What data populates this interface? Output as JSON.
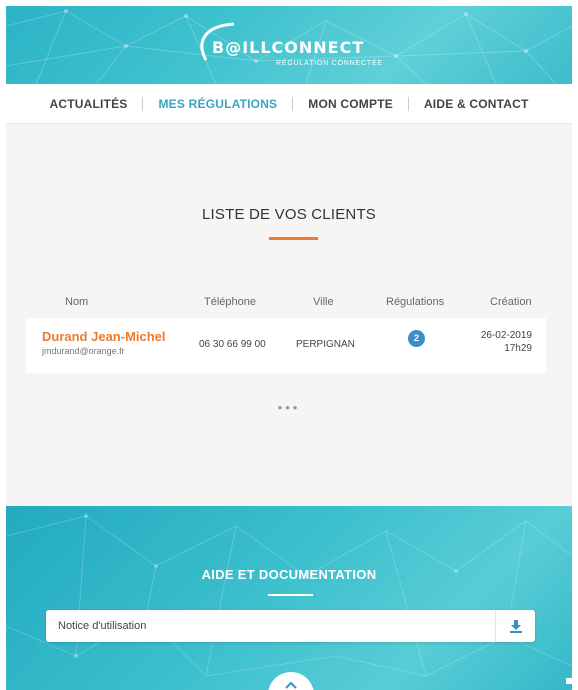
{
  "brand": {
    "name": "B@ILLCONNECT",
    "tagline": "RÉGULATION CONNECTÉE"
  },
  "nav": {
    "items": [
      {
        "label": "ACTUALITÉS",
        "active": false
      },
      {
        "label": "MES RÉGULATIONS",
        "active": true
      },
      {
        "label": "MON COMPTE",
        "active": false
      },
      {
        "label": "AIDE & CONTACT",
        "active": false
      }
    ]
  },
  "clients": {
    "title": "LISTE DE VOS CLIENTS",
    "columns": {
      "name": "Nom",
      "phone": "Téléphone",
      "city": "Ville",
      "regulations": "Régulations",
      "created": "Création"
    },
    "rows": [
      {
        "name": "Durand Jean-Michel",
        "email": "jmdurand@orange.fr",
        "phone": "06 30 66 99 00",
        "city": "PERPIGNAN",
        "regulations": "2",
        "created_date": "26-02-2019",
        "created_time": "17h29"
      }
    ],
    "more_label": "•••"
  },
  "help": {
    "title": "AIDE ET DOCUMENTATION",
    "documents": [
      {
        "label": "Notice d'utilisation"
      }
    ]
  },
  "colors": {
    "accent": "#ee7a2c",
    "primary": "#3aa5bf",
    "badge": "#3a8fc9",
    "teal_bg": "#3cbfcd"
  },
  "icons": {
    "download": "download-icon",
    "scroll": "chevron-up-icon"
  }
}
